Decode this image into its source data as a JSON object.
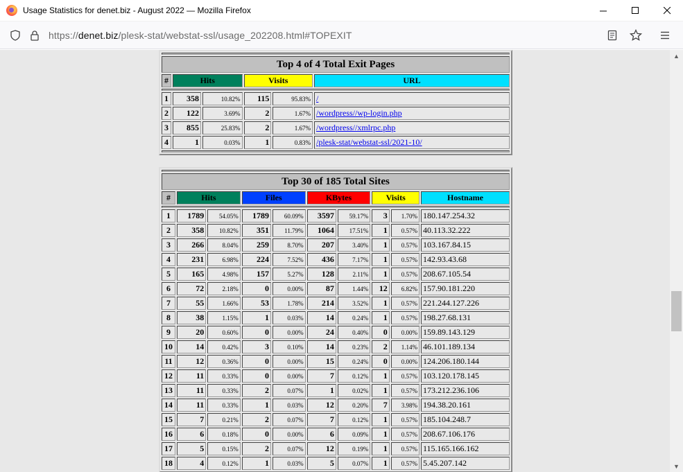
{
  "window": {
    "title": "Usage Statistics for denet.biz - August 2022 — Mozilla Firefox",
    "minimize": "—",
    "maximize": "☐",
    "close": "✕"
  },
  "navbar": {
    "url_prefix": "https://",
    "url_domain": "denet.biz",
    "url_path": "/plesk-stat/webstat-ssl/usage_202208.html#TOPEXIT"
  },
  "exit_pages": {
    "title": "Top 4 of 4 Total Exit Pages",
    "headers": {
      "num": "#",
      "hits": "Hits",
      "visits": "Visits",
      "url": "URL"
    },
    "rows": [
      {
        "n": "1",
        "hits": "358",
        "hits_pct": "10.82%",
        "visits": "115",
        "visits_pct": "95.83%",
        "url": "/"
      },
      {
        "n": "2",
        "hits": "122",
        "hits_pct": "3.69%",
        "visits": "2",
        "visits_pct": "1.67%",
        "url": "/wordpress//wp-login.php"
      },
      {
        "n": "3",
        "hits": "855",
        "hits_pct": "25.83%",
        "visits": "2",
        "visits_pct": "1.67%",
        "url": "/wordpress//xmlrpc.php"
      },
      {
        "n": "4",
        "hits": "1",
        "hits_pct": "0.03%",
        "visits": "1",
        "visits_pct": "0.83%",
        "url": "/plesk-stat/webstat-ssl/2021-10/"
      }
    ]
  },
  "sites": {
    "title": "Top 30 of 185 Total Sites",
    "headers": {
      "num": "#",
      "hits": "Hits",
      "files": "Files",
      "kbytes": "KBytes",
      "visits": "Visits",
      "hostname": "Hostname"
    },
    "rows": [
      {
        "n": "1",
        "hits": "1789",
        "hits_pct": "54.05%",
        "files": "1789",
        "files_pct": "60.09%",
        "kb": "3597",
        "kb_pct": "59.17%",
        "visits": "3",
        "visits_pct": "1.70%",
        "host": "180.147.254.32"
      },
      {
        "n": "2",
        "hits": "358",
        "hits_pct": "10.82%",
        "files": "351",
        "files_pct": "11.79%",
        "kb": "1064",
        "kb_pct": "17.51%",
        "visits": "1",
        "visits_pct": "0.57%",
        "host": "40.113.32.222"
      },
      {
        "n": "3",
        "hits": "266",
        "hits_pct": "8.04%",
        "files": "259",
        "files_pct": "8.70%",
        "kb": "207",
        "kb_pct": "3.40%",
        "visits": "1",
        "visits_pct": "0.57%",
        "host": "103.167.84.15"
      },
      {
        "n": "4",
        "hits": "231",
        "hits_pct": "6.98%",
        "files": "224",
        "files_pct": "7.52%",
        "kb": "436",
        "kb_pct": "7.17%",
        "visits": "1",
        "visits_pct": "0.57%",
        "host": "142.93.43.68"
      },
      {
        "n": "5",
        "hits": "165",
        "hits_pct": "4.98%",
        "files": "157",
        "files_pct": "5.27%",
        "kb": "128",
        "kb_pct": "2.11%",
        "visits": "1",
        "visits_pct": "0.57%",
        "host": "208.67.105.54"
      },
      {
        "n": "6",
        "hits": "72",
        "hits_pct": "2.18%",
        "files": "0",
        "files_pct": "0.00%",
        "kb": "87",
        "kb_pct": "1.44%",
        "visits": "12",
        "visits_pct": "6.82%",
        "host": "157.90.181.220"
      },
      {
        "n": "7",
        "hits": "55",
        "hits_pct": "1.66%",
        "files": "53",
        "files_pct": "1.78%",
        "kb": "214",
        "kb_pct": "3.52%",
        "visits": "1",
        "visits_pct": "0.57%",
        "host": "221.244.127.226"
      },
      {
        "n": "8",
        "hits": "38",
        "hits_pct": "1.15%",
        "files": "1",
        "files_pct": "0.03%",
        "kb": "14",
        "kb_pct": "0.24%",
        "visits": "1",
        "visits_pct": "0.57%",
        "host": "198.27.68.131"
      },
      {
        "n": "9",
        "hits": "20",
        "hits_pct": "0.60%",
        "files": "0",
        "files_pct": "0.00%",
        "kb": "24",
        "kb_pct": "0.40%",
        "visits": "0",
        "visits_pct": "0.00%",
        "host": "159.89.143.129"
      },
      {
        "n": "10",
        "hits": "14",
        "hits_pct": "0.42%",
        "files": "3",
        "files_pct": "0.10%",
        "kb": "14",
        "kb_pct": "0.23%",
        "visits": "2",
        "visits_pct": "1.14%",
        "host": "46.101.189.134"
      },
      {
        "n": "11",
        "hits": "12",
        "hits_pct": "0.36%",
        "files": "0",
        "files_pct": "0.00%",
        "kb": "15",
        "kb_pct": "0.24%",
        "visits": "0",
        "visits_pct": "0.00%",
        "host": "124.206.180.144"
      },
      {
        "n": "12",
        "hits": "11",
        "hits_pct": "0.33%",
        "files": "0",
        "files_pct": "0.00%",
        "kb": "7",
        "kb_pct": "0.12%",
        "visits": "1",
        "visits_pct": "0.57%",
        "host": "103.120.178.145"
      },
      {
        "n": "13",
        "hits": "11",
        "hits_pct": "0.33%",
        "files": "2",
        "files_pct": "0.07%",
        "kb": "1",
        "kb_pct": "0.02%",
        "visits": "1",
        "visits_pct": "0.57%",
        "host": "173.212.236.106"
      },
      {
        "n": "14",
        "hits": "11",
        "hits_pct": "0.33%",
        "files": "1",
        "files_pct": "0.03%",
        "kb": "12",
        "kb_pct": "0.20%",
        "visits": "7",
        "visits_pct": "3.98%",
        "host": "194.38.20.161"
      },
      {
        "n": "15",
        "hits": "7",
        "hits_pct": "0.21%",
        "files": "2",
        "files_pct": "0.07%",
        "kb": "7",
        "kb_pct": "0.12%",
        "visits": "1",
        "visits_pct": "0.57%",
        "host": "185.104.248.7"
      },
      {
        "n": "16",
        "hits": "6",
        "hits_pct": "0.18%",
        "files": "0",
        "files_pct": "0.00%",
        "kb": "6",
        "kb_pct": "0.09%",
        "visits": "1",
        "visits_pct": "0.57%",
        "host": "208.67.106.176"
      },
      {
        "n": "17",
        "hits": "5",
        "hits_pct": "0.15%",
        "files": "2",
        "files_pct": "0.07%",
        "kb": "12",
        "kb_pct": "0.19%",
        "visits": "1",
        "visits_pct": "0.57%",
        "host": "115.165.166.162"
      },
      {
        "n": "18",
        "hits": "4",
        "hits_pct": "0.12%",
        "files": "1",
        "files_pct": "0.03%",
        "kb": "5",
        "kb_pct": "0.07%",
        "visits": "1",
        "visits_pct": "0.57%",
        "host": "5.45.207.142"
      }
    ]
  },
  "colors": {
    "hits": "#00805c",
    "files": "#0040ff",
    "kbytes": "#ff0000",
    "visits": "#ffff00",
    "url": "#00e0ff"
  }
}
